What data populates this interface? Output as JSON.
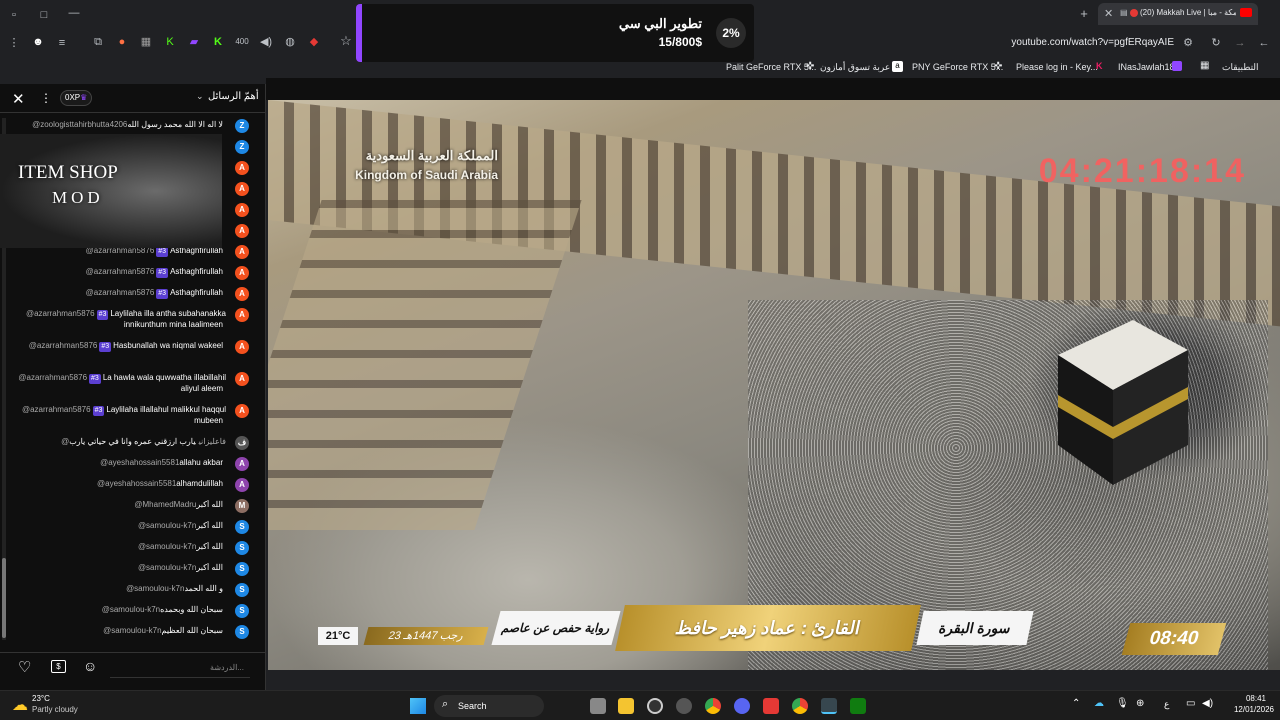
{
  "browser": {
    "tab_title": "(20) Makkah Live | مكة - مبا",
    "url": "youtube.com/watch?v=pgfERqayAIE",
    "bookmarks": [
      "Palit GeForce RTX 5...",
      "عربة تسوق أمازون",
      "PNY GeForce RTX 5...",
      "Please log in - Key...",
      "INasJawlah18",
      "التطبيقات"
    ]
  },
  "donation": {
    "title": "تطوير البي سي",
    "amount": "15/800$",
    "percent": "2%"
  },
  "chat": {
    "header_title": "أهمّ الرسائل",
    "xp_label": "0XP",
    "input_placeholder": "الدردشة...",
    "item_shop_line1": "ITEM SHOP",
    "item_shop_line2": "MOD",
    "messages": [
      {
        "author": "@zoologisttahirbhutta4206",
        "text": "لا اله الا الله محمد رسول الله",
        "avatar": "Z",
        "color": "#1e88e5",
        "badge": ""
      },
      {
        "author": "",
        "text": "",
        "avatar": "Z",
        "color": "#1e88e5",
        "badge": ""
      },
      {
        "author": "",
        "text": "",
        "avatar": "A",
        "color": "#f4511e",
        "badge": ""
      },
      {
        "author": "",
        "text": "",
        "avatar": "A",
        "color": "#f4511e",
        "badge": ""
      },
      {
        "author": "",
        "text": "",
        "avatar": "A",
        "color": "#f4511e",
        "badge": ""
      },
      {
        "author": "",
        "text": "",
        "avatar": "A",
        "color": "#f4511e",
        "badge": ""
      },
      {
        "author": "@azarrahman5876",
        "text": "Asthaghfirullah",
        "avatar": "A",
        "color": "#f4511e",
        "badge": "#3"
      },
      {
        "author": "@azarrahman5876",
        "text": "Asthaghfirullah",
        "avatar": "A",
        "color": "#f4511e",
        "badge": "#3"
      },
      {
        "author": "@azarrahman5876",
        "text": "Asthaghfirullah",
        "avatar": "A",
        "color": "#f4511e",
        "badge": "#3"
      },
      {
        "author": "@azarrahman5876",
        "text": "Laylilaha illa antha subahanakka innikunthum mina laalimeen",
        "avatar": "A",
        "color": "#f4511e",
        "badge": "#3"
      },
      {
        "author": "@azarrahman5876",
        "text": "Hasbunallah wa niqmal wakeel",
        "avatar": "A",
        "color": "#f4511e",
        "badge": "#3"
      },
      {
        "author": "@azarrahman5876",
        "text": "La hawla wala quwwatha illabillahil aliyul aleem",
        "avatar": "A",
        "color": "#f4511e",
        "badge": "#3"
      },
      {
        "author": "@azarrahman5876",
        "text": "Laylilaha illallahul malikkul haqqul mubeen",
        "avatar": "A",
        "color": "#f4511e",
        "badge": "#3"
      },
      {
        "author": "@فاعليزاني",
        "text": "يارب ارزقني عمره وانا في حياتي يارب",
        "avatar": "ف",
        "color": "#555555",
        "badge": ""
      },
      {
        "author": "@ayeshahossain5581",
        "text": "allahu akbar",
        "avatar": "A",
        "color": "#8e44ad",
        "badge": ""
      },
      {
        "author": "@ayeshahossain5581",
        "text": "alhamdulillah",
        "avatar": "A",
        "color": "#8e44ad",
        "badge": ""
      },
      {
        "author": "@MhamedMadru",
        "text": "الله أكبر",
        "avatar": "M",
        "color": "#8d6e63",
        "badge": ""
      },
      {
        "author": "@samoulou-k7n",
        "text": "الله أكبر",
        "avatar": "S",
        "color": "#1e88e5",
        "badge": ""
      },
      {
        "author": "@samoulou-k7n",
        "text": "الله أكبر",
        "avatar": "S",
        "color": "#1e88e5",
        "badge": ""
      },
      {
        "author": "@samoulou-k7n",
        "text": "الله أكبر",
        "avatar": "S",
        "color": "#1e88e5",
        "badge": ""
      },
      {
        "author": "@samoulou-k7n",
        "text": "و الله الحمد",
        "avatar": "S",
        "color": "#1e88e5",
        "badge": ""
      },
      {
        "author": "@samoulou-k7n",
        "text": "سبحان الله وبحمده",
        "avatar": "S",
        "color": "#1e88e5",
        "badge": ""
      },
      {
        "author": "@samoulou-k7n",
        "text": "سبحان الله العظيم",
        "avatar": "S",
        "color": "#1e88e5",
        "badge": ""
      }
    ]
  },
  "video": {
    "watermark_ar": "المملكة العربية السعودية",
    "watermark_en": "Kingdom of Saudi Arabia",
    "clock": "04:21:18:14",
    "surah": "سورة البقرة",
    "reciter": "القارئ : عماد زهير حافظ",
    "riwaya": "رواية حفص عن عاصم",
    "hijri_date": "23 رجب 1447هـ",
    "temperature": "21°C",
    "time": "08:40"
  },
  "taskbar": {
    "weather_temp": "23°C",
    "weather_desc": "Partly cloudy",
    "search_label": "Search",
    "clock_time": "08:41",
    "clock_date": "12/01/2026",
    "lang": "ع"
  }
}
